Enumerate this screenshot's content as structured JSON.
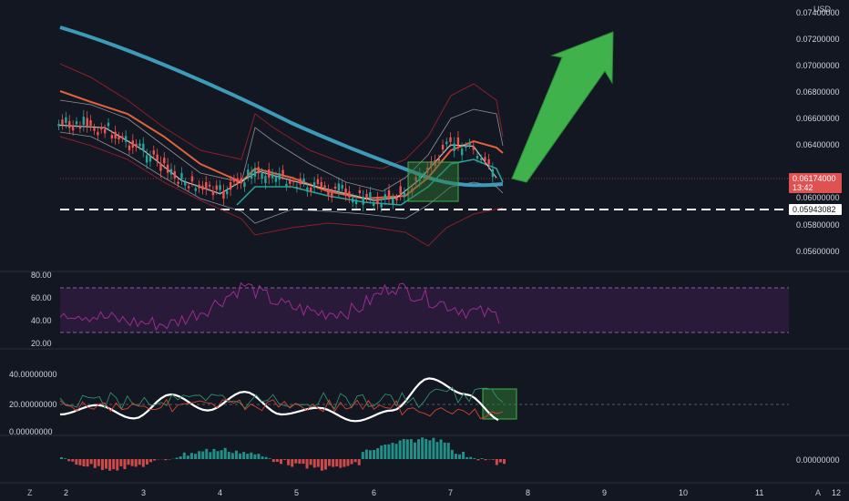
{
  "currency_label": "USD",
  "corner_left": "Z",
  "corner_right": "A",
  "x_ticks": [
    "2",
    "3",
    "4",
    "5",
    "6",
    "7",
    "8",
    "9",
    "10",
    "11",
    "12"
  ],
  "price_axis": [
    "0.07400000",
    "0.07200000",
    "0.07000000",
    "0.06800000",
    "0.06600000",
    "0.06400000",
    "0.06000000",
    "0.05800000",
    "0.05600000"
  ],
  "price_tag": {
    "value": "0.06174000",
    "countdown": "13:42",
    "color": "#e05252"
  },
  "support_tag": {
    "value": "0.05943082"
  },
  "rsi_axis": [
    "80.00",
    "60.00",
    "40.00",
    "20.00"
  ],
  "osc_axis": [
    "40.00000000",
    "20.00000000",
    "0.00000000"
  ],
  "macd_axis": [
    "0.00000000"
  ],
  "colors": {
    "bg": "#131722",
    "ma_long": "#3d9ab8",
    "ma_short": "#e0623a",
    "band": "#8b1f2a",
    "rsi": "#9b2c8e",
    "rsi_zone": "#2a1a3a",
    "up": "#26a69a",
    "down": "#ef5350",
    "arrow": "#3fb24b"
  },
  "chart_data": [
    {
      "type": "line",
      "title": "",
      "x_unit": "day",
      "x": [
        1.9,
        2.5,
        3.0,
        3.5,
        4.0,
        4.5,
        5.0,
        5.5,
        6.0,
        6.3,
        6.6,
        7.0,
        7.3,
        7.6
      ],
      "series": [
        {
          "values": [
            0.0657,
            0.0655,
            0.0638,
            0.0615,
            0.0605,
            0.0622,
            0.0614,
            0.0607,
            0.06,
            0.0602,
            0.0616,
            0.0642,
            0.0641,
            0.0617
          ]
        }
      ],
      "y_range": [
        0.055,
        0.0745
      ],
      "support_level": 0.05943082,
      "current_price": 0.06174
    },
    {
      "type": "line",
      "title": "",
      "series": [
        {
          "values": [
            50,
            45,
            40,
            38,
            52,
            72,
            55,
            48,
            50,
            72,
            60,
            50,
            45
          ]
        }
      ],
      "y_range": [
        20,
        80
      ],
      "band": [
        30,
        70
      ]
    },
    {
      "type": "line",
      "title": "",
      "series": [
        {
          "values": [
            15,
            22,
            12,
            30,
            18,
            32,
            15,
            20,
            10,
            18,
            42,
            30,
            10
          ]
        }
      ],
      "y_range": [
        0,
        45
      ]
    }
  ]
}
